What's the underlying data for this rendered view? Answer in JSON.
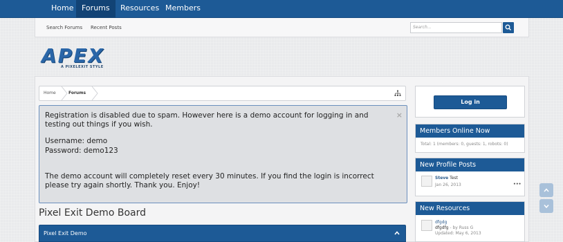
{
  "topnav": {
    "tabs": [
      {
        "label": "Home"
      },
      {
        "label": "Forums",
        "active": true
      },
      {
        "label": "Resources"
      },
      {
        "label": "Members"
      }
    ]
  },
  "subnav": {
    "links": [
      "Search Forums",
      "Recent Posts"
    ],
    "search_placeholder": "Search..."
  },
  "logo": {
    "text": "APEX",
    "subtitle": "A PIXELEXIT STYLE"
  },
  "breadcrumb": [
    "Home",
    "Forums"
  ],
  "notice": {
    "line1": "Registration is disabled due to spam. However here is a demo account for logging in and testing out things if you wish.",
    "username": "Username: demo",
    "password": "Password: demo123",
    "line2": "The demo account will completely reset every 30 minutes. If you find the login is incorrect please try again shortly. Thank you. Enjoy!",
    "close": "×"
  },
  "board_title": "Pixel Exit Demo Board",
  "category": {
    "label": "Pixel Exit Demo"
  },
  "sidebar": {
    "login_label": "Log in",
    "members_online": {
      "title": "Members Online Now",
      "summary": "Total: 1 (members: 0, guests: 1, robots: 0)"
    },
    "profile_posts": {
      "title": "New Profile Posts",
      "author": "Steve",
      "text": "Test",
      "date": "Jan 26, 2013",
      "more": "•••"
    },
    "resources": {
      "title": "New Resources",
      "name": "dfgdg",
      "desc": "dfgdfg",
      "by": " - by Russ G",
      "updated": "Updated: May 6, 2013"
    }
  },
  "colors": {
    "accent": "#1d5a96",
    "accent_dark": "#124375"
  }
}
